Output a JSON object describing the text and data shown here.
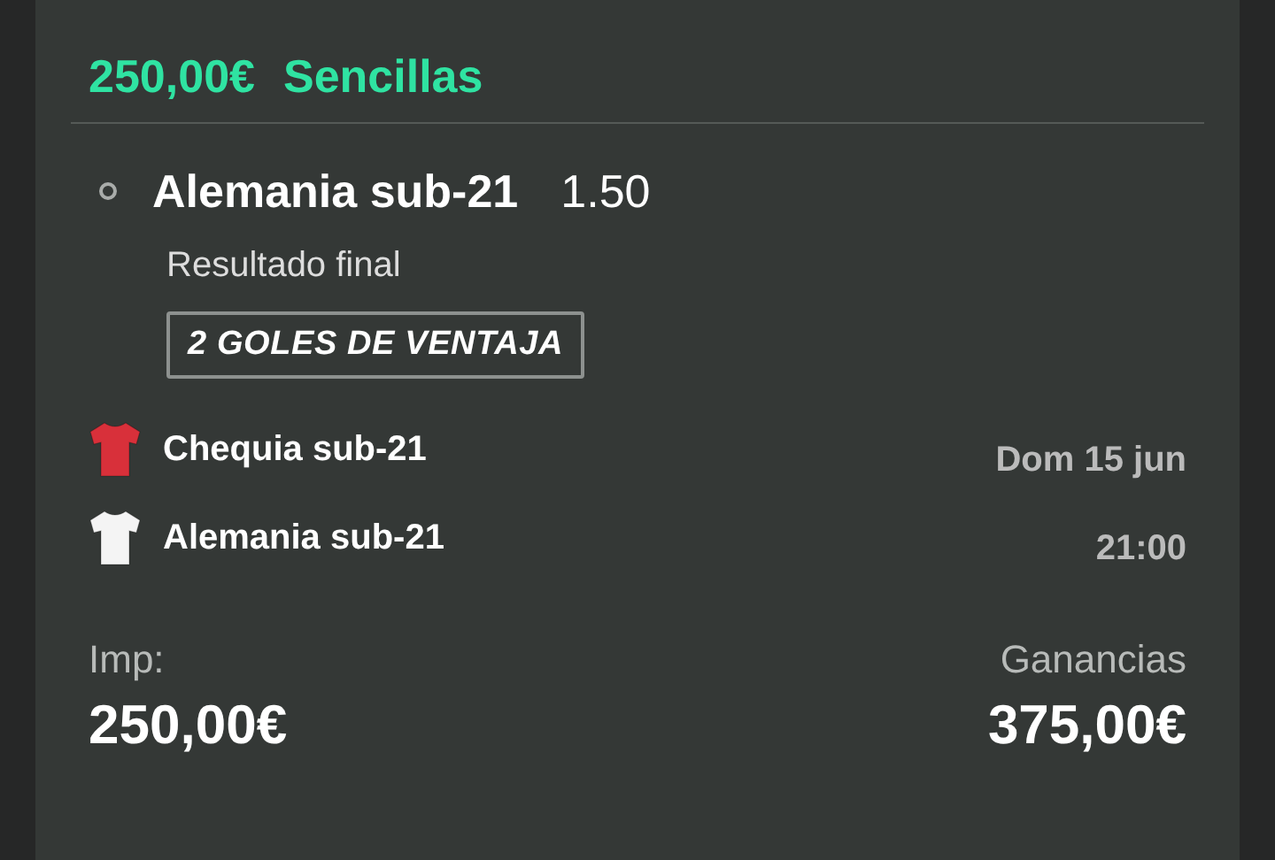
{
  "header": {
    "amount": "250,00€",
    "type": "Sencillas"
  },
  "selection": {
    "selected": false,
    "name": "Alemania sub-21",
    "odds": "1.50",
    "market": "Resultado final",
    "badge": "2 GOLES DE VENTAJA"
  },
  "teams": [
    {
      "name": "Chequia sub-21",
      "color": "#d8303a",
      "info": "Dom 15 jun"
    },
    {
      "name": "Alemania sub-21",
      "color": "#f4f4f4",
      "info": "21:00"
    }
  ],
  "stake": {
    "label": "Imp:",
    "value": "250,00€"
  },
  "winnings": {
    "label": "Ganancias",
    "value": "375,00€"
  }
}
